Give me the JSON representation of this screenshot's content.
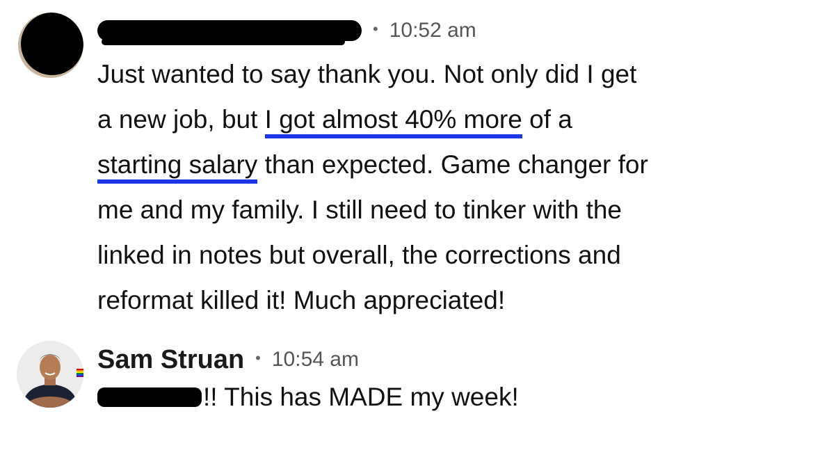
{
  "messages": [
    {
      "author": "",
      "author_redacted": true,
      "separator": "•",
      "time": "10:52 am",
      "lines": [
        {
          "text": "Just wanted to say thank you. Not only did I get"
        },
        {
          "pre": "a new job, but ",
          "highlight": "I got almost 40% more",
          "post": " of a"
        },
        {
          "highlight": "starting salary",
          "post": " than expected. Game changer for"
        },
        {
          "text": "me and my family. I still need to tinker with the"
        },
        {
          "text": "linked in notes but overall, the corrections and"
        },
        {
          "text": "reformat killed it! Much appreciated!"
        }
      ]
    },
    {
      "author": "Sam Struan",
      "separator": "•",
      "time": "10:54 am",
      "mention_redacted": true,
      "text": "!! This has MADE my week!"
    }
  ],
  "colors": {
    "highlight_underline": "#1c35e6",
    "text": "#111111",
    "meta": "#555555"
  }
}
